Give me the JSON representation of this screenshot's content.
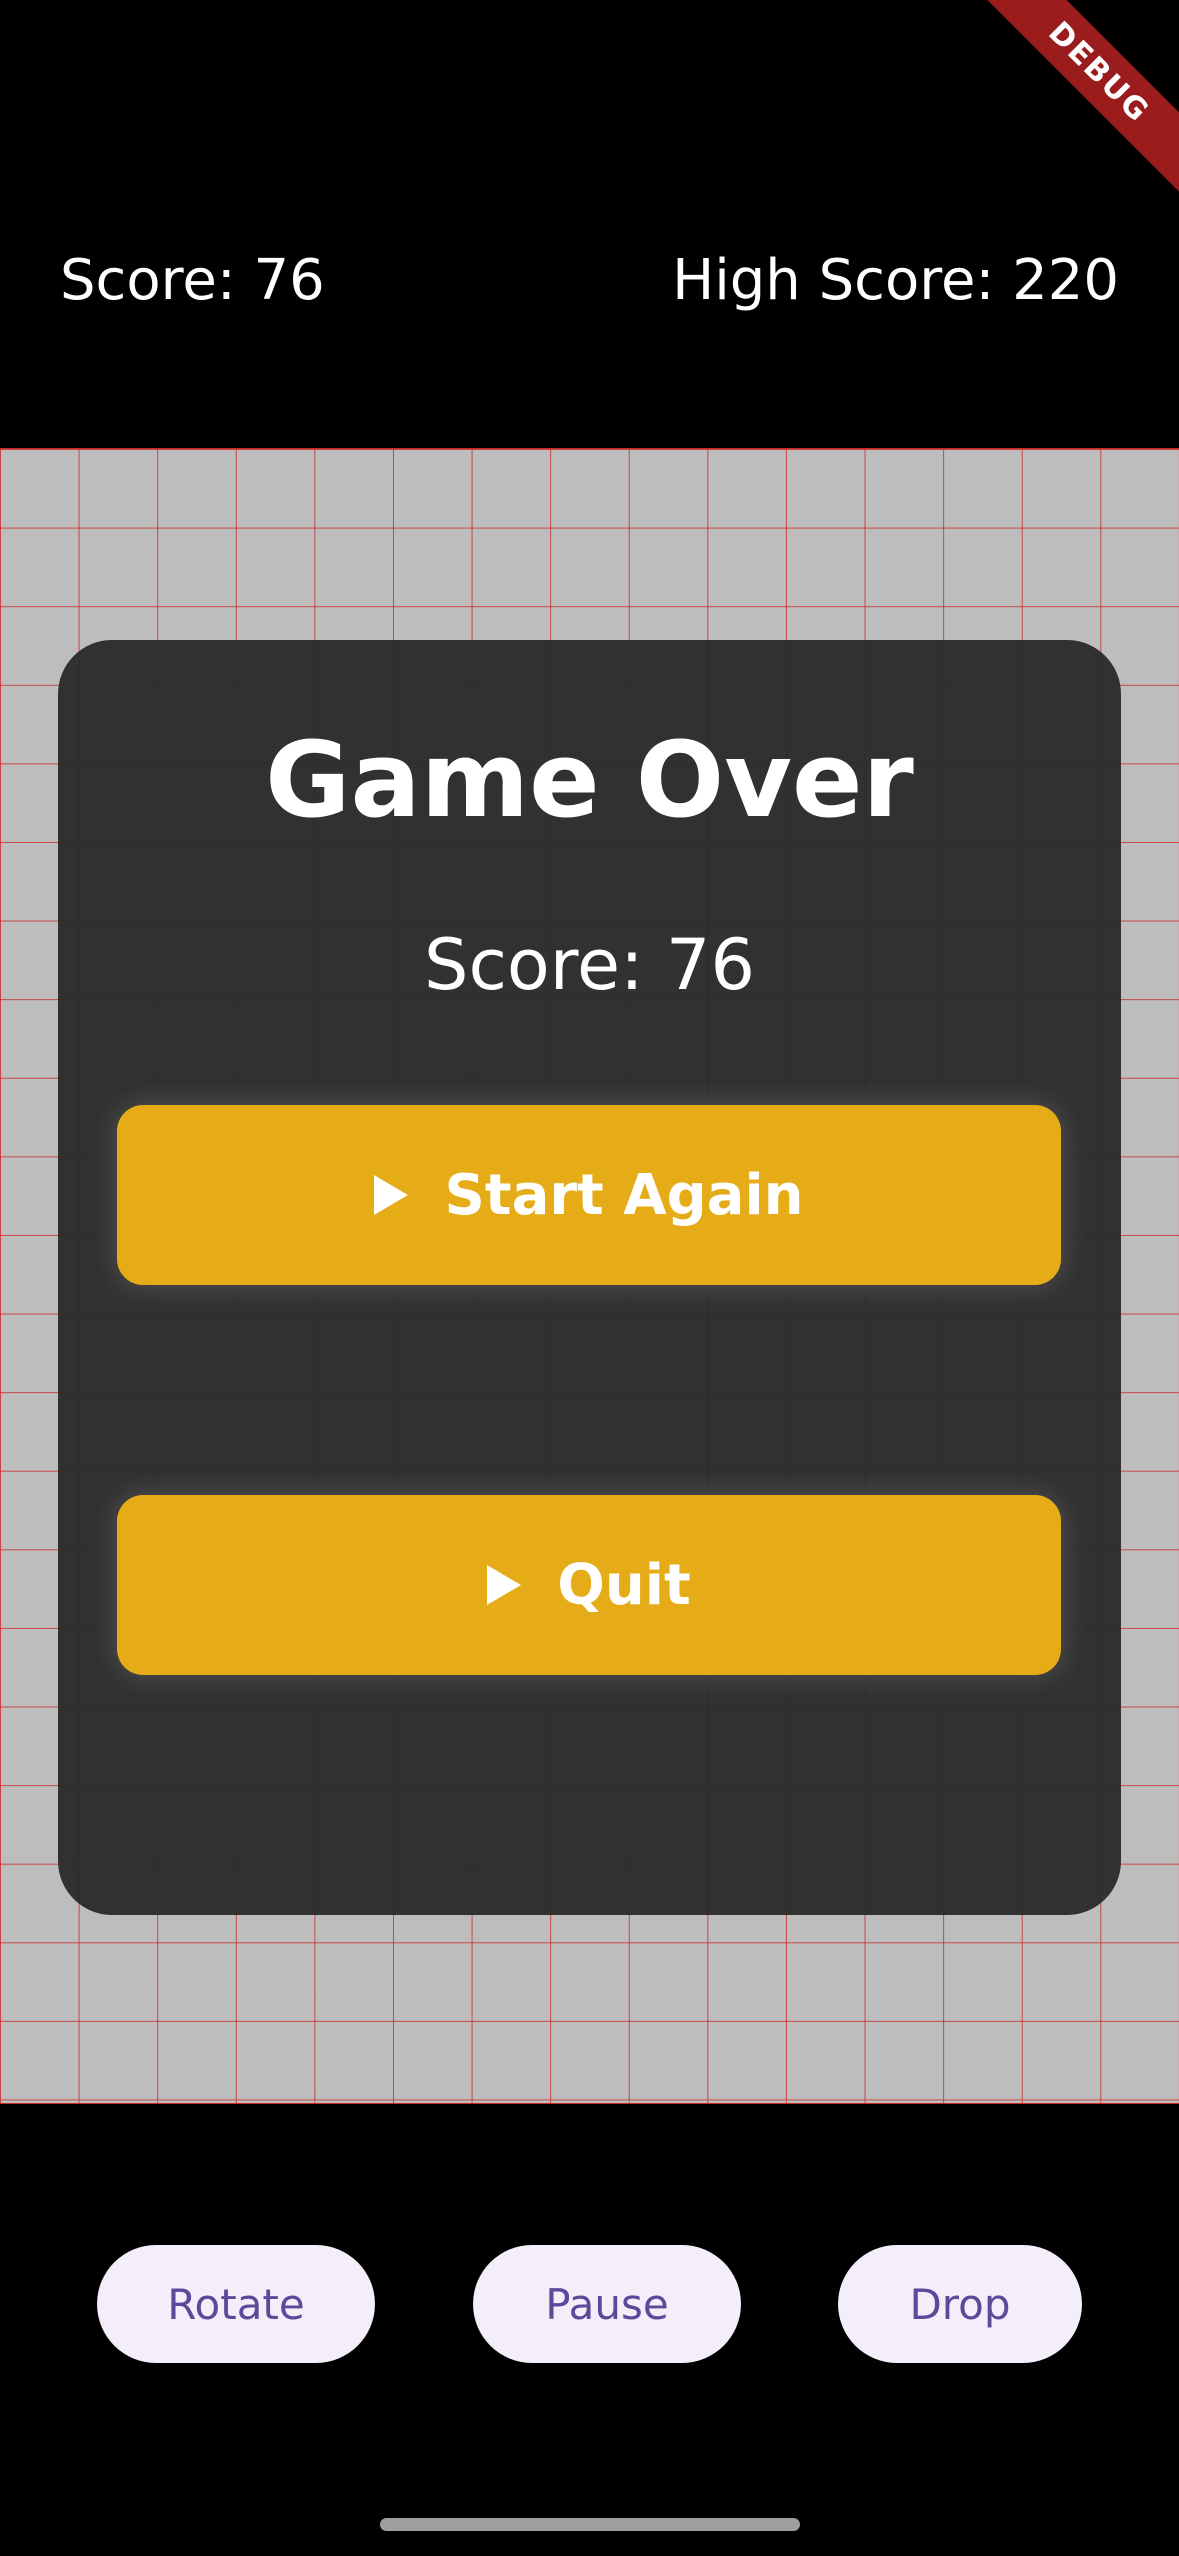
{
  "debug_badge": "DEBUG",
  "header": {
    "score_text": "Score: 76",
    "high_score_text": "High Score: 220"
  },
  "board": {
    "background_color": "#bdbdbd",
    "grid_line_color": "#c62828"
  },
  "game_over_dialog": {
    "title": "Game Over",
    "score_text": "Score: 76",
    "start_again_label": "Start Again",
    "quit_label": "Quit",
    "button_color": "#e6ac18",
    "button_icon": "play-icon"
  },
  "controls": {
    "rotate_label": "Rotate",
    "pause_label": "Pause",
    "drop_label": "Drop"
  }
}
